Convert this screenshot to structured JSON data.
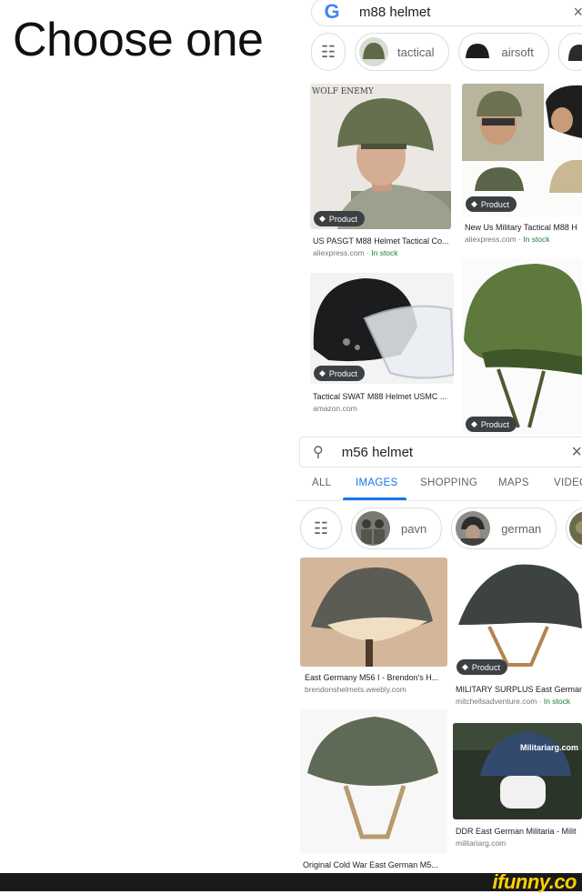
{
  "heading": "Choose one",
  "top": {
    "logo": "G",
    "query": "m88 helmet",
    "chips": [
      "tactical",
      "airsoft"
    ],
    "results": [
      {
        "title": "US PASGT M88 Helmet Tactical Co...",
        "source": "aliexpress.com · ",
        "stock": "In stock",
        "badge": "Product",
        "watermark": "WOLF ENEMY"
      },
      {
        "title": "New Us Military Tactical M88 H",
        "source": "aliexpress.com · ",
        "stock": "In stock",
        "badge": "Product"
      },
      {
        "title": "Tactical SWAT M88 Helmet USMC ...",
        "source": "amazon.com",
        "badge": "Product"
      },
      {
        "badge": "Product"
      }
    ]
  },
  "bottom": {
    "query": "m56 helmet",
    "tabs": [
      "ALL",
      "IMAGES",
      "SHOPPING",
      "MAPS",
      "VIDEO"
    ],
    "active_tab": "IMAGES",
    "chips": [
      "pavn",
      "german"
    ],
    "results": [
      {
        "title": "East Germany M56 I - Brendon's H...",
        "source": "brendonshelmets.weebly.com"
      },
      {
        "title": "MILITARY SURPLUS East German",
        "source": "mitchellsadventure.com · ",
        "stock": "In stock",
        "badge": "Product"
      },
      {
        "title": "Original Cold War East German M5...",
        "source": ""
      },
      {
        "title": "DDR East German Militaria - Milit",
        "source": "militariarg.com",
        "watermark": "Militariarg.com"
      }
    ]
  },
  "footer": {
    "brand": "ifunny.co"
  },
  "colors": {
    "accent": "#1a73e8",
    "instock": "#188038",
    "badge_bg": "#3c4043",
    "brand": "#fcd000"
  }
}
